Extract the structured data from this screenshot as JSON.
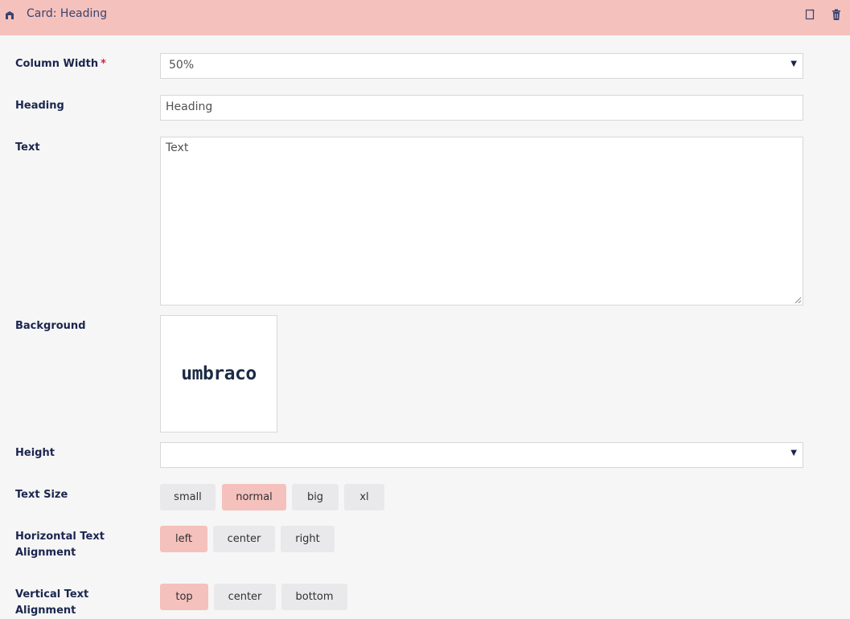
{
  "header": {
    "title": "Card: Heading",
    "type_icon": "element-type-icon",
    "actions": [
      "copy-icon",
      "delete-icon"
    ],
    "background_color": "#f5c1bc"
  },
  "fields": {
    "column_width": {
      "label": "Column Width",
      "required_mark": "*",
      "value": "50%"
    },
    "heading": {
      "label": "Heading",
      "value": "Heading"
    },
    "text": {
      "label": "Text",
      "value": "Text"
    },
    "background": {
      "label": "Background",
      "image_text": "umbraco"
    },
    "height": {
      "label": "Height",
      "value": ""
    },
    "text_size": {
      "label": "Text Size",
      "options": [
        "small",
        "normal",
        "big",
        "xl"
      ],
      "selected": "normal"
    },
    "horizontal_alignment": {
      "label": "Horizontal Text Alignment",
      "label_line1": "Horizontal Text",
      "label_line2": "Alignment",
      "options": [
        "left",
        "center",
        "right"
      ],
      "selected": "left"
    },
    "vertical_alignment": {
      "label": "Vertical Text Alignment",
      "options": [
        "top",
        "center",
        "bottom"
      ],
      "selected": "top"
    }
  },
  "colors": {
    "selected_option": "#f5c1bc",
    "unselected_option": "#e9e9eb",
    "required": "#d42054"
  }
}
